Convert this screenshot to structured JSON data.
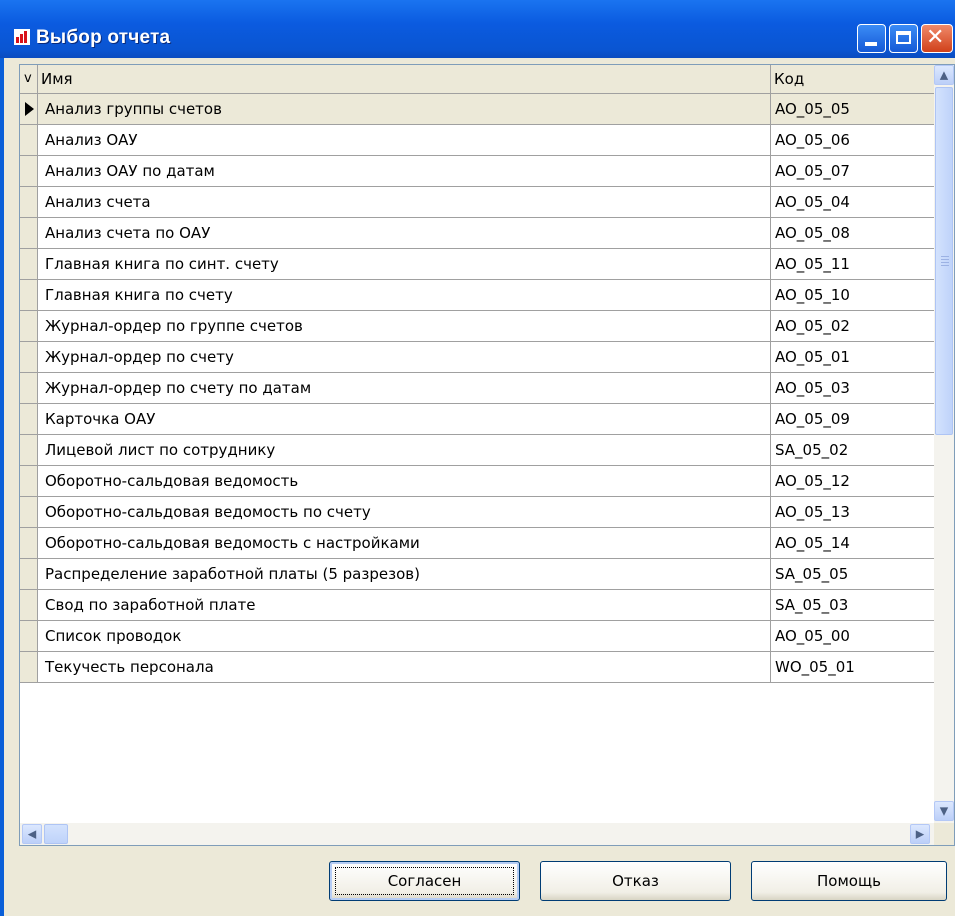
{
  "window": {
    "title": "Выбор отчета",
    "icon": "bar-chart-icon",
    "controls": [
      "minimize-icon",
      "maximize-icon",
      "close-icon"
    ]
  },
  "grid": {
    "columns": {
      "indicator": "v",
      "name": "Имя",
      "code": "Код"
    },
    "selected_index": 0,
    "rows": [
      {
        "name": "Анализ группы счетов",
        "code": "AO_05_05"
      },
      {
        "name": "Анализ ОАУ",
        "code": "AO_05_06"
      },
      {
        "name": "Анализ ОАУ по датам",
        "code": "AO_05_07"
      },
      {
        "name": "Анализ счета",
        "code": "AO_05_04"
      },
      {
        "name": "Анализ счета по ОАУ",
        "code": "AO_05_08"
      },
      {
        "name": "Главная книга по синт. счету",
        "code": "AO_05_11"
      },
      {
        "name": "Главная книга по счету",
        "code": "AO_05_10"
      },
      {
        "name": "Журнал-ордер по группе счетов",
        "code": "AO_05_02"
      },
      {
        "name": "Журнал-ордер по счету",
        "code": "AO_05_01"
      },
      {
        "name": "Журнал-ордер по счету по датам",
        "code": "AO_05_03"
      },
      {
        "name": "Карточка ОАУ",
        "code": "AO_05_09"
      },
      {
        "name": "Лицевой лист по сотруднику",
        "code": "SA_05_02"
      },
      {
        "name": "Оборотно-сальдовая ведомость",
        "code": "AO_05_12"
      },
      {
        "name": "Оборотно-сальдовая ведомость по счету",
        "code": "AO_05_13"
      },
      {
        "name": "Оборотно-сальдовая ведомость с настройками",
        "code": "AO_05_14"
      },
      {
        "name": "Распределение заработной платы (5 разрезов)",
        "code": "SA_05_05"
      },
      {
        "name": "Свод по заработной плате",
        "code": "SA_05_03"
      },
      {
        "name": "Список проводок",
        "code": "AO_05_00"
      },
      {
        "name": "Текучесть персонала",
        "code": "WO_05_01"
      }
    ]
  },
  "buttons": {
    "ok": "Согласен",
    "cancel": "Отказ",
    "help": "Помощь"
  },
  "colors": {
    "titlebar": "#0a5fd8",
    "dialog_face": "#ece9d8",
    "grid_line": "#a0a0a0"
  }
}
